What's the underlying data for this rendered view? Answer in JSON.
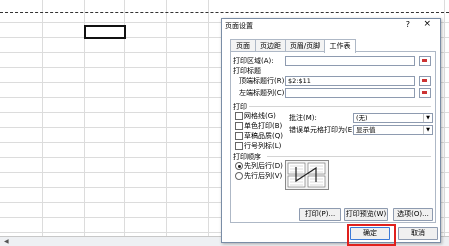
{
  "dialog": {
    "title": "页面设置",
    "help_glyph": "?",
    "close_glyph": "×",
    "tabs": [
      "页面",
      "页边距",
      "页眉/页脚",
      "工作表"
    ],
    "active_tab": "工作表"
  },
  "sheet_tab": {
    "print_area_label": "打印区域(A):",
    "print_area_value": "",
    "print_titles_label": "打印标题",
    "top_rows_label": "顶端标题行(R):",
    "top_rows_value": "$2:$11",
    "left_cols_label": "左端标题列(C):",
    "left_cols_value": "",
    "print_section_label": "打印",
    "gridlines_label": "网格线(G)",
    "bw_label": "单色打印(B)",
    "draft_label": "草稿品质(Q)",
    "rowcol_label": "行号列标(L)",
    "comments_label": "批注(M):",
    "comments_value": "(无)",
    "errors_label": "错误单元格打印为(E):",
    "errors_value": "显示值",
    "order_label": "打印顺序",
    "down_then_over_label": "先列后行(D)",
    "over_then_down_label": "先行后列(V)"
  },
  "buttons": {
    "print": "打印(P)...",
    "preview": "打印预览(W)",
    "options": "选项(O)...",
    "ok": "确定",
    "cancel": "取消"
  },
  "colors": {
    "highlight_border": "#e0201d",
    "collapse_icon": "#cc3333"
  }
}
